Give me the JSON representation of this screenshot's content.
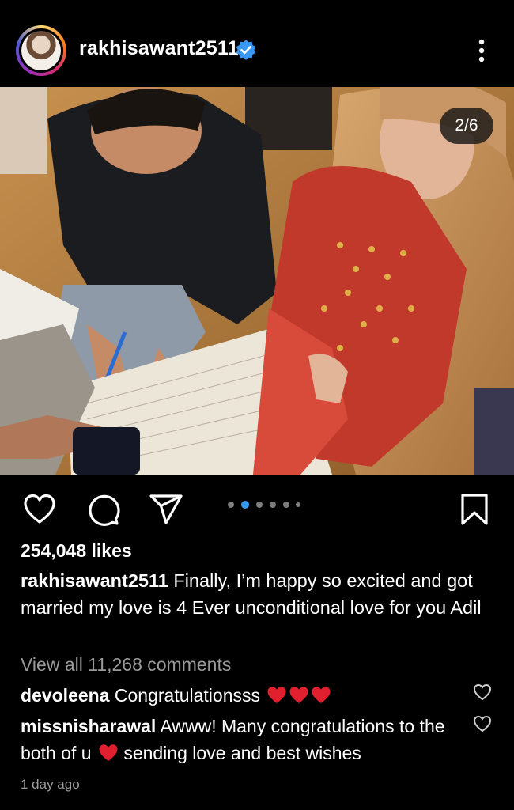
{
  "post": {
    "username": "rakhisawant2511",
    "image_counter": "2/6",
    "carousel": {
      "total": 6,
      "current": 2
    },
    "likes": "254,048 likes",
    "caption": {
      "username": "rakhisawant2511",
      "text": "Finally, I’m happy so excited and got married my love is 4 Ever unconditional love for you Adil"
    },
    "view_comments": "View all 11,268 comments",
    "comments": [
      {
        "username": "devoleena",
        "text": "Congratulationsss",
        "emoji_hearts": 3
      },
      {
        "username": "missnisharawal",
        "text_before": "Awww! Many congratulations to the both of u",
        "text_after": "sending love and best wishes",
        "emoji_hearts": 1
      }
    ],
    "timestamp": "1 day ago"
  },
  "colors": {
    "background": "#000000",
    "verified_badge": "#3897f0",
    "active_dot": "#3897f0",
    "heart_emoji": "#e0202e",
    "secondary_text": "#9a9a9a"
  },
  "icons": [
    "verified-badge-icon",
    "more-options-icon",
    "like-icon",
    "comment-icon",
    "share-icon",
    "save-icon",
    "comment-like-icon"
  ]
}
